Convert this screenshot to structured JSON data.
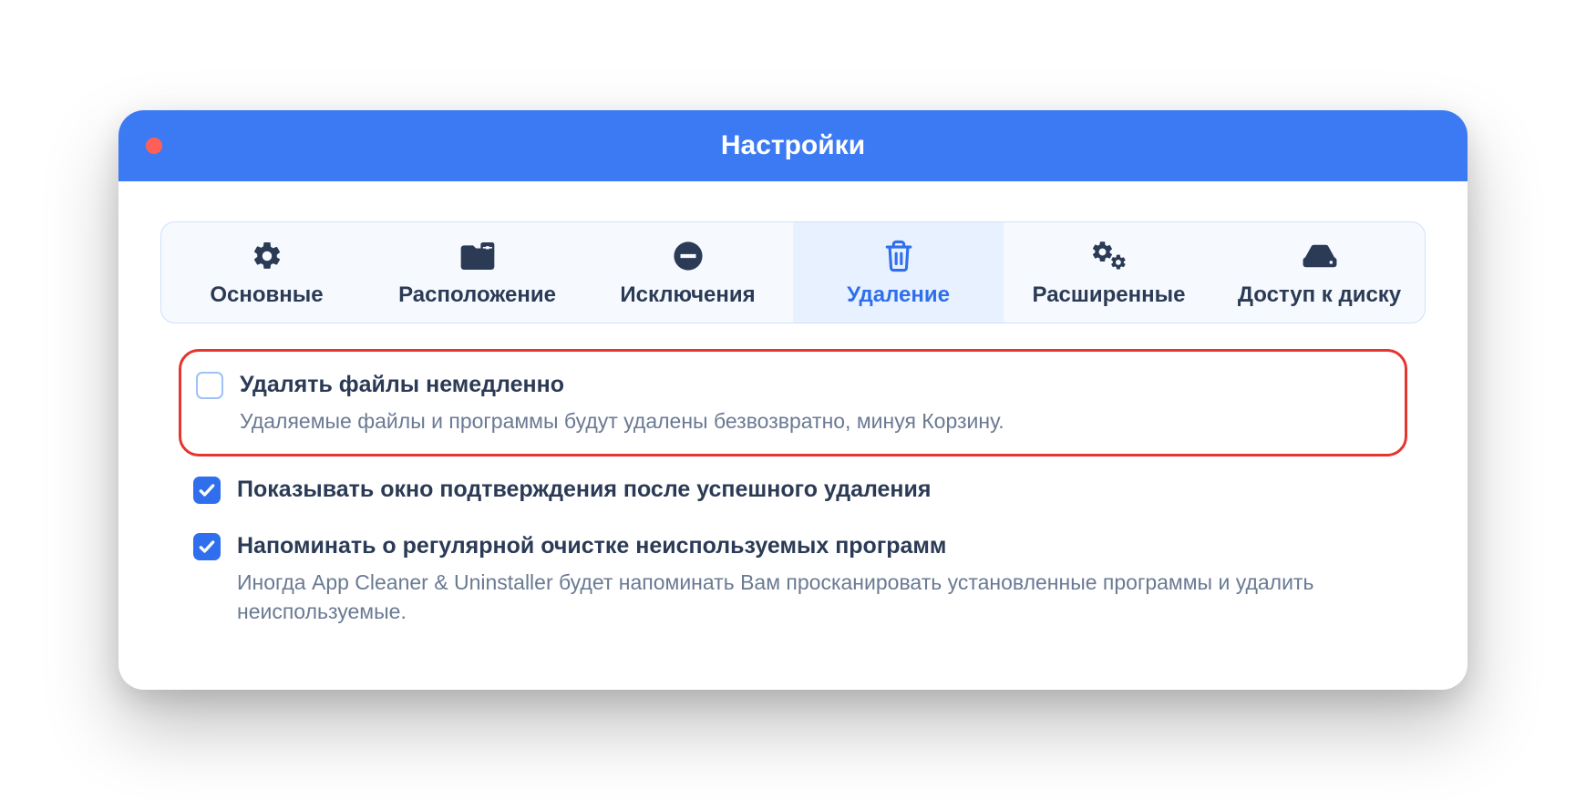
{
  "window": {
    "title": "Настройки"
  },
  "tabs": [
    {
      "label": "Основные",
      "icon": "gear-icon",
      "active": false
    },
    {
      "label": "Расположение",
      "icon": "folder-icon",
      "active": false
    },
    {
      "label": "Исключения",
      "icon": "minus-icon",
      "active": false
    },
    {
      "label": "Удаление",
      "icon": "trash-icon",
      "active": true
    },
    {
      "label": "Расширенные",
      "icon": "gears-icon",
      "active": false
    },
    {
      "label": "Доступ к диску",
      "icon": "disk-icon",
      "active": false
    }
  ],
  "options": [
    {
      "checked": false,
      "highlighted": true,
      "title": "Удалять файлы немедленно",
      "desc": "Удаляемые файлы и программы будут удалены безвозвратно, минуя Корзину."
    },
    {
      "checked": true,
      "highlighted": false,
      "title": "Показывать окно подтверждения после успешного удаления",
      "desc": ""
    },
    {
      "checked": true,
      "highlighted": false,
      "title": "Напоминать о регулярной очистке неиспользуемых программ",
      "desc": "Иногда App Cleaner & Uninstaller будет напоминать Вам просканировать установленные программы и удалить неиспользуемые."
    }
  ]
}
